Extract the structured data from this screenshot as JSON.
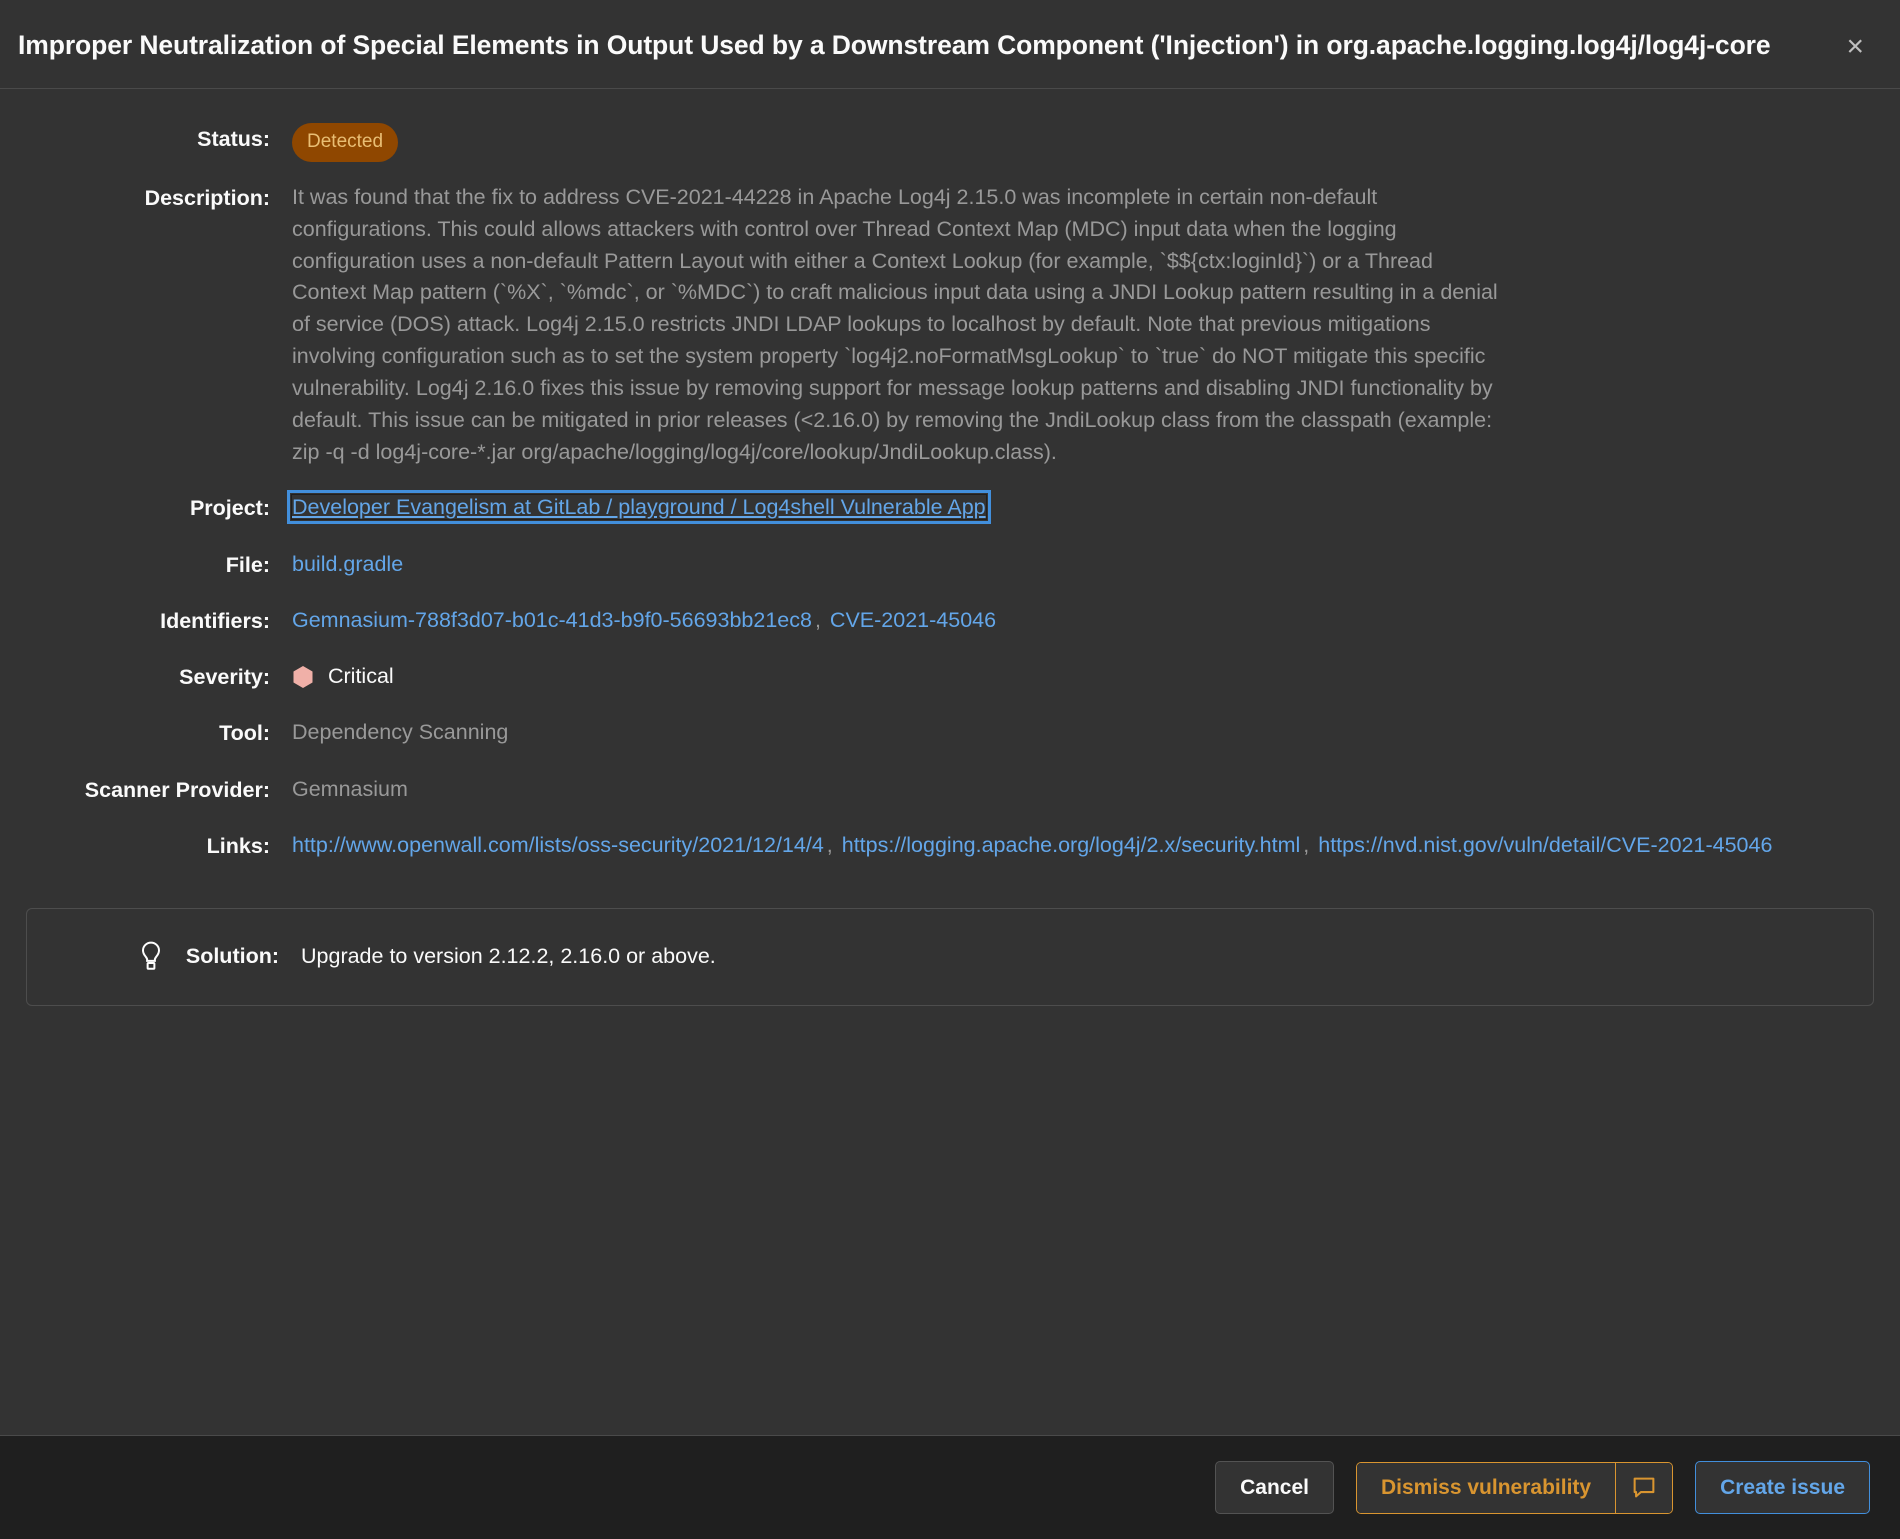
{
  "modal": {
    "title": "Improper Neutralization of Special Elements in Output Used by a Downstream Component ('Injection') in org.apache.logging.log4j/log4j-core",
    "close_label": "×"
  },
  "fields": {
    "status_label": "Status:",
    "status_value": "Detected",
    "description_label": "Description:",
    "description_value": "It was found that the fix to address CVE-2021-44228 in Apache Log4j 2.15.0 was incomplete in certain non-default configurations. This could allows attackers with control over Thread Context Map (MDC) input data when the logging configuration uses a non-default Pattern Layout with either a Context Lookup (for example, `$${ctx:loginId}`) or a Thread Context Map pattern (`%X`, `%mdc`, or `%MDC`) to craft malicious input data using a JNDI Lookup pattern resulting in a denial of service (DOS) attack. Log4j 2.15.0 restricts JNDI LDAP lookups to localhost by default. Note that previous mitigations involving configuration such as to set the system property `log4j2.noFormatMsgLookup` to `true` do NOT mitigate this specific vulnerability. Log4j 2.16.0 fixes this issue by removing support for message lookup patterns and disabling JNDI functionality by default. This issue can be mitigated in prior releases (<2.16.0) by removing the JndiLookup class from the classpath (example: zip -q -d log4j-core-*.jar org/apache/logging/log4j/core/lookup/JndiLookup.class).",
    "project_label": "Project:",
    "project_value": "Developer Evangelism at GitLab / playground / Log4shell Vulnerable App",
    "file_label": "File:",
    "file_value": "build.gradle",
    "identifiers_label": "Identifiers:",
    "identifiers": [
      "Gemnasium-788f3d07-b01c-41d3-b9f0-56693bb21ec8",
      "CVE-2021-45046"
    ],
    "identifiers_separator": ",",
    "severity_label": "Severity:",
    "severity_value": "Critical",
    "severity_color": "#f0b0a8",
    "tool_label": "Tool:",
    "tool_value": "Dependency Scanning",
    "scanner_provider_label": "Scanner Provider:",
    "scanner_provider_value": "Gemnasium",
    "links_label": "Links:",
    "links": [
      "http://www.openwall.com/lists/oss-security/2021/12/14/4",
      "https://logging.apache.org/log4j/2.x/security.html",
      "https://nvd.nist.gov/vuln/detail/CVE-2021-45046"
    ],
    "links_separator": ","
  },
  "solution": {
    "label": "Solution:",
    "value": "Upgrade to version 2.12.2, 2.16.0 or above."
  },
  "footer": {
    "cancel_label": "Cancel",
    "dismiss_label": "Dismiss vulnerability",
    "create_issue_label": "Create issue"
  },
  "colors": {
    "accent_blue": "#63a6e9",
    "accent_orange": "#d99530",
    "badge_bg": "#8f4700",
    "badge_fg": "#e9be74",
    "surface": "#333333",
    "footer_bg": "#1f1f1f"
  }
}
